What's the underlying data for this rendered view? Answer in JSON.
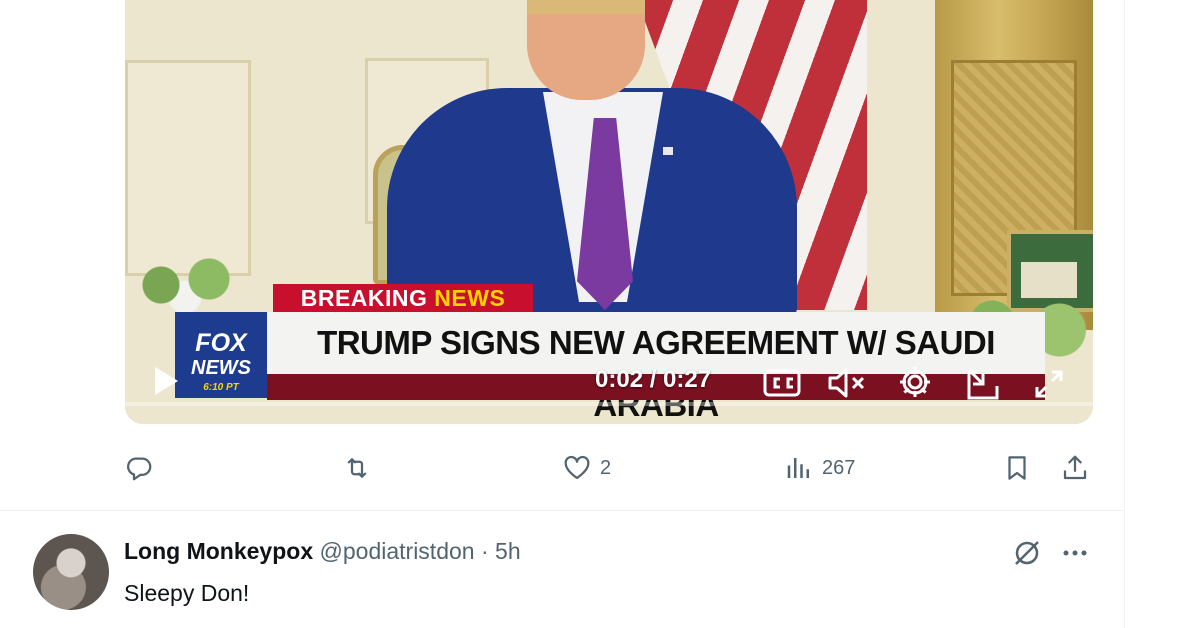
{
  "video": {
    "breaking_label_part1": "BREAKING ",
    "breaking_label_part2": "NEWS",
    "headline": "TRUMP SIGNS NEW AGREEMENT W/ SAUDI ARABIA",
    "network_logo_line1": "FOX",
    "network_logo_line2": "NEWS",
    "network_logo_line3": "6:10 PT",
    "timecode": "0:02 / 0:27",
    "icons": [
      "play-icon",
      "closed-captions-icon",
      "muted-speaker-icon",
      "gear-icon",
      "pop-out-icon",
      "fullscreen-icon"
    ]
  },
  "actions": {
    "reply_count": "",
    "repost_count": "",
    "like_count": "2",
    "view_count": "267",
    "icons": [
      "reply-icon",
      "repost-icon",
      "heart-icon",
      "views-icon",
      "bookmark-icon",
      "share-icon"
    ]
  },
  "reply": {
    "display_name": "Long Monkeypox",
    "handle": "@podiatristdon",
    "separator": "·",
    "time": "5h",
    "text": "Sleepy Don!"
  },
  "colors": {
    "breaking_red": "#c8102e",
    "breaking_accent": "#ffd200",
    "fox_blue": "#1d3c8f",
    "muted_text": "#536471",
    "primary_text": "#0f1419"
  }
}
